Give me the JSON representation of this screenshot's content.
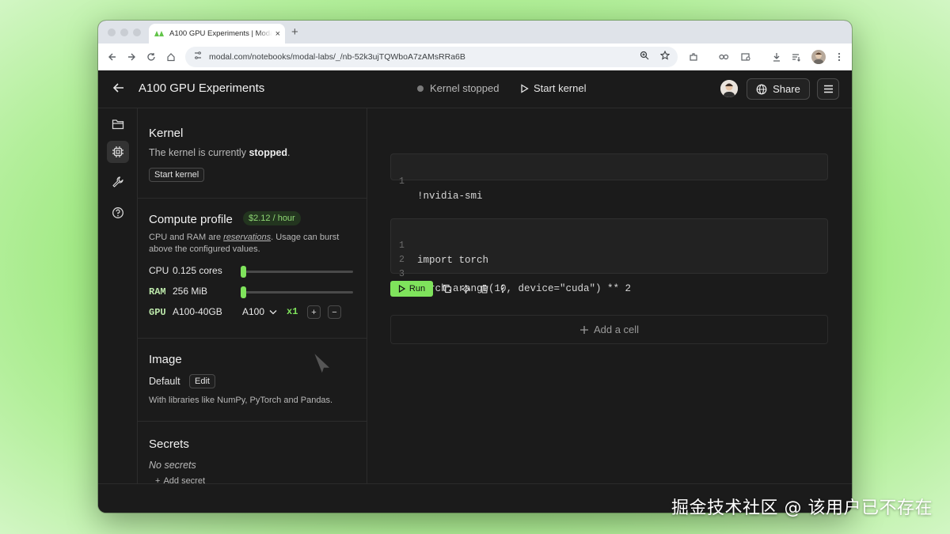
{
  "browser": {
    "tab_title": "A100 GPU Experiments | Modal",
    "new_tab": "+",
    "tab_close": "×",
    "url": "modal.com/notebooks/modal-labs/_/nb-52k3ujTQWboA7zAMsRRa6B"
  },
  "header": {
    "title": "A100 GPU Experiments",
    "kernel_status": "Kernel stopped",
    "start_kernel": "Start kernel",
    "share": "Share"
  },
  "kernel": {
    "heading": "Kernel",
    "description_prefix": "The kernel is currently ",
    "description_state": "stopped",
    "description_suffix": ".",
    "start_button": "Start kernel"
  },
  "compute": {
    "heading": "Compute profile",
    "price": "$2.12 / hour",
    "desc_prefix": "CPU and RAM are ",
    "desc_link": "reservations",
    "desc_suffix": ". Usage can burst above the configured values.",
    "cpu_label": "CPU",
    "cpu_value": "0.125 cores",
    "cpu_level": 0.0,
    "ram_label": "RAM",
    "ram_value": "256 MiB",
    "ram_level": 0.0,
    "gpu_label": "GPU",
    "gpu_value": "A100-40GB",
    "gpu_select": "A100",
    "gpu_count": "x1",
    "plus": "+",
    "minus": "−"
  },
  "image": {
    "heading": "Image",
    "name": "Default",
    "edit": "Edit",
    "description": "With libraries like NumPy, PyTorch and Pandas."
  },
  "secrets": {
    "heading": "Secrets",
    "empty": "No secrets",
    "add": "Add secret"
  },
  "cells": [
    {
      "lines": [
        {
          "n": "1",
          "text": "!nvidia-smi"
        }
      ]
    },
    {
      "lines": [
        {
          "n": "1",
          "text": "import torch"
        },
        {
          "n": "2",
          "text": ""
        },
        {
          "n": "3",
          "text": "torch.arange(10, device=\"cuda\") ** 2"
        }
      ]
    }
  ],
  "toolbar": {
    "run": "Run",
    "add_cell": "Add a cell"
  },
  "watermark": "掘金技术社区 @ 该用户已不存在",
  "colors": {
    "accent": "#7fe35c",
    "background": "#1b1b1b"
  }
}
